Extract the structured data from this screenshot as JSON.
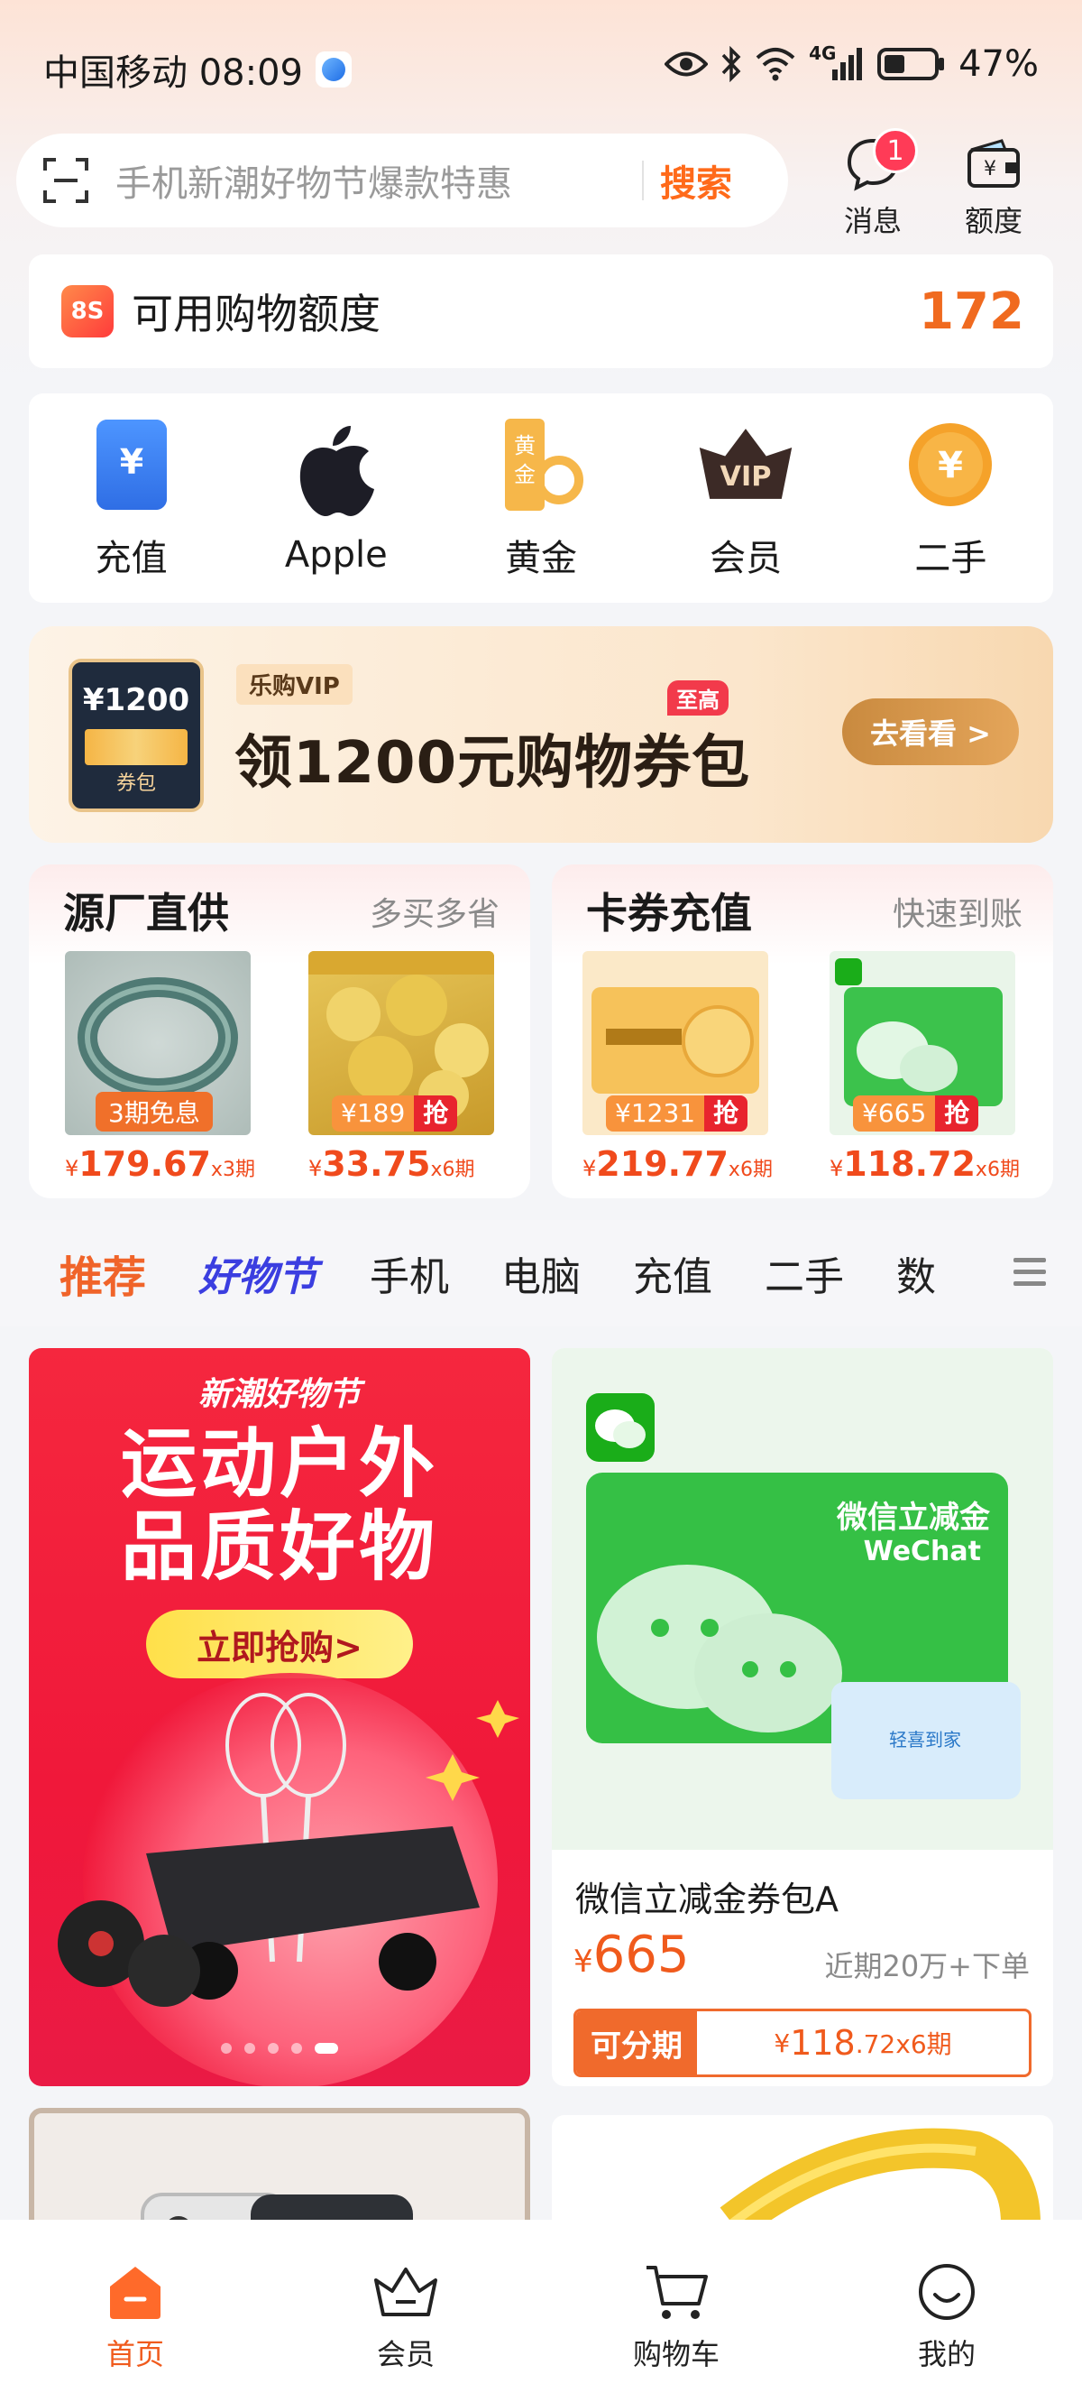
{
  "status_bar": {
    "carrier_time": "中国移动 08:09",
    "network": "4G",
    "battery": "47%"
  },
  "search": {
    "placeholder": "手机新潮好物节爆款特惠",
    "button": "搜索"
  },
  "header_actions": {
    "messages_label": "消息",
    "messages_badge": "1",
    "quota_label": "额度"
  },
  "quota_card": {
    "logo_text": "8S",
    "title": "可用购物额度",
    "value": "172"
  },
  "shortcuts": [
    {
      "label": "充值",
      "icon": "recharge-icon"
    },
    {
      "label": "Apple",
      "icon": "apple-icon"
    },
    {
      "label": "黄金",
      "icon": "gold-icon"
    },
    {
      "label": "会员",
      "icon": "vip-icon"
    },
    {
      "label": "二手",
      "icon": "second-hand-icon"
    }
  ],
  "vip_banner": {
    "coupon_amount": "¥1200",
    "coupon_tag": "券包",
    "brand_tag": "乐购VIP",
    "highlight": "至高",
    "title": "领1200元购物券包",
    "button": "去看看 >"
  },
  "modules": [
    {
      "title": "源厂直供",
      "subtitle": "多买多省",
      "items": [
        {
          "badge": "3期免息",
          "yen": "¥",
          "price": "179.67",
          "period": "x3期"
        },
        {
          "badge_price": "¥189",
          "badge_grab": "抢",
          "yen": "¥",
          "price": "33.75",
          "period": "x6期"
        }
      ]
    },
    {
      "title": "卡券充值",
      "subtitle": "快速到账",
      "items": [
        {
          "badge_price": "¥1231",
          "badge_grab": "抢",
          "yen": "¥",
          "price": "219.77",
          "period": "x6期"
        },
        {
          "badge_price": "¥665",
          "badge_grab": "抢",
          "yen": "¥",
          "price": "118.72",
          "period": "x6期"
        }
      ]
    }
  ],
  "tabs": [
    {
      "label": "推荐"
    },
    {
      "label": "好物节"
    },
    {
      "label": "手机"
    },
    {
      "label": "电脑"
    },
    {
      "label": "充值"
    },
    {
      "label": "二手"
    },
    {
      "label": "数"
    }
  ],
  "promo": {
    "brand": "新潮好物节",
    "line1": "运动户外",
    "line2": "品质好物",
    "cta": "立即抢购>"
  },
  "product_card": {
    "img_title": "微信立减金",
    "img_sub": "WeChat",
    "img_tag": "轻喜到家",
    "name": "微信立减金券包A",
    "yen": "¥",
    "price": "665",
    "sold": "近期20万+下单",
    "installment_label": "可分期",
    "installment_yen": "¥",
    "installment_int": "118",
    "installment_dec": ".72x6期"
  },
  "bottom_nav": [
    {
      "label": "首页",
      "icon": "home-icon"
    },
    {
      "label": "会员",
      "icon": "crown-icon"
    },
    {
      "label": "购物车",
      "icon": "cart-icon"
    },
    {
      "label": "我的",
      "icon": "smile-icon"
    }
  ],
  "colors": {
    "accent": "#f06a1f",
    "badge": "#ff3b57",
    "fest_tab": "#3b3ee0"
  }
}
